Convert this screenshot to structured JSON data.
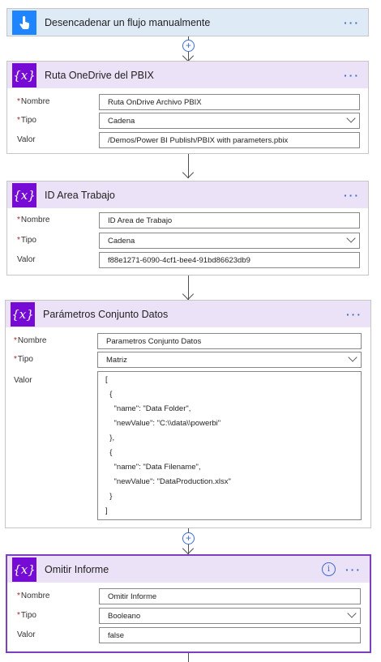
{
  "trigger": {
    "title": "Desencadenar un flujo manualmente",
    "more": "···"
  },
  "card1": {
    "title": "Ruta OneDrive del PBIX",
    "more": "···",
    "name_label": "Nombre",
    "name_value": "Ruta OnDrive Archivo PBIX",
    "type_label": "Tipo",
    "type_value": "Cadena",
    "value_label": "Valor",
    "value_value": "/Demos/Power BI Publish/PBIX with parameters.pbix"
  },
  "card2": {
    "title": "ID Area Trabajo",
    "more": "···",
    "name_label": "Nombre",
    "name_value": "ID Area de Trabajo",
    "type_label": "Tipo",
    "type_value": "Cadena",
    "value_label": "Valor",
    "value_value": "f88e1271-6090-4cf1-bee4-91bd86623db9"
  },
  "card3": {
    "title": "Parámetros Conjunto Datos",
    "more": "···",
    "name_label": "Nombre",
    "name_value": "Parametros Conjunto Datos",
    "type_label": "Tipo",
    "type_value": "Matriz",
    "value_label": "Valor",
    "value_lines": [
      "[",
      "  {",
      "    \"name\": \"Data Folder\",",
      "    \"newValue\": \"C:\\\\data\\\\powerbi\"",
      "  },",
      "  {",
      "    \"name\": \"Data Filename\",",
      "    \"newValue\": \"DataProduction.xlsx\"",
      "  }",
      "]"
    ]
  },
  "card4": {
    "title": "Omitir Informe",
    "more": "···",
    "info": "i",
    "name_label": "Nombre",
    "name_value": "Omitir Informe",
    "type_label": "Tipo",
    "type_value": "Booleano",
    "value_label": "Valor",
    "value_value": "false"
  },
  "connector": {
    "plus": "+",
    "required_mark": "*"
  },
  "icons": {
    "trigger": "touch-hand-icon",
    "variable": "variable-x-icon",
    "add": "plus-circle-icon",
    "info": "info-icon",
    "chevron": "chevron-down-icon",
    "more": "ellipsis-icon"
  },
  "colors": {
    "variable_header": "#ece2f7",
    "variable_badge": "#770bd6",
    "trigger_header": "#deebf7",
    "trigger_badge": "#1f85ff",
    "selected_border": "#7c3fbf",
    "required": "#a4262c"
  }
}
